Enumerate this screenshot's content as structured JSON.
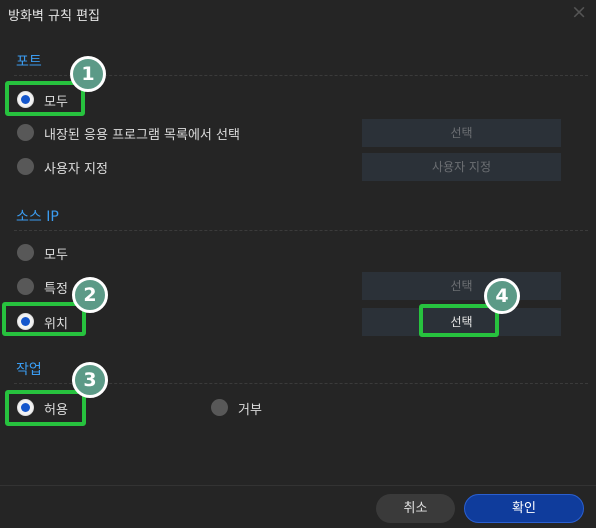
{
  "dialog": {
    "title": "방화벽 규칙 편집"
  },
  "port": {
    "heading": "포트",
    "options": [
      "모두",
      "내장된 응용 프로그램 목록에서 선택",
      "사용자 지정"
    ],
    "selected": "모두",
    "select_button": "선택",
    "custom_button": "사용자 지정"
  },
  "source_ip": {
    "heading": "소스 IP",
    "options": [
      "모두",
      "특정",
      "위치"
    ],
    "selected": "위치",
    "specific_button": "선택",
    "location_button": "선택"
  },
  "action": {
    "heading": "작업",
    "options": [
      "허용",
      "거부"
    ],
    "selected": "허용"
  },
  "footer": {
    "cancel": "취소",
    "confirm": "확인"
  },
  "badges": [
    "1",
    "2",
    "3",
    "4"
  ],
  "colors": {
    "accent": "#3b9cf0",
    "highlight": "#27c23e",
    "badge": "#5c9a87",
    "primary_button": "#0f3c9c"
  }
}
